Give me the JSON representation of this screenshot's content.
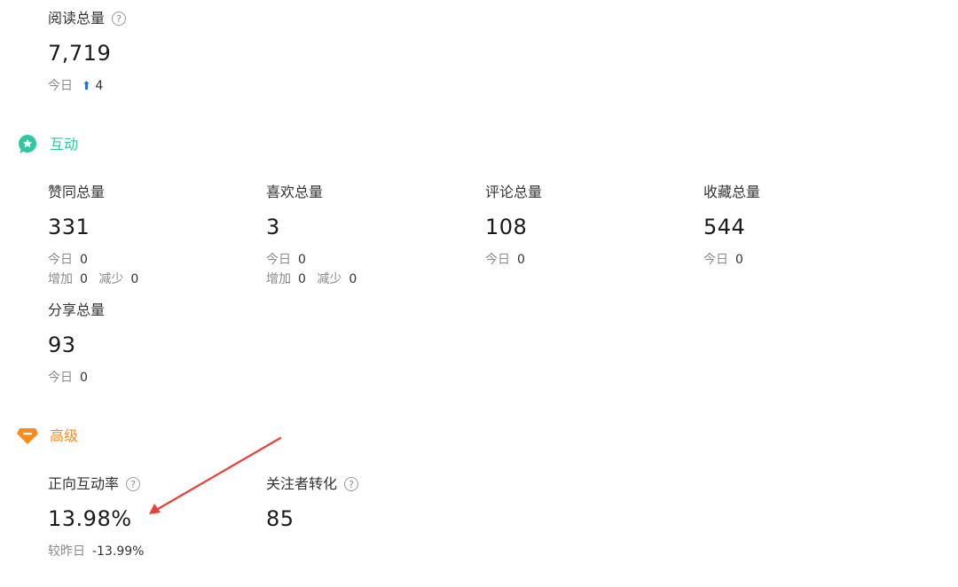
{
  "reading": {
    "title": "阅读总量",
    "help_icon": "question-circle-icon",
    "value": "7,719",
    "today_label": "今日",
    "today_value": "4",
    "trend_icon": "arrow-up-icon"
  },
  "interaction": {
    "title": "互动",
    "icon": "star-chat-bubble-icon",
    "color": "#2fc8a0",
    "metrics": [
      {
        "label": "赞同总量",
        "value": "331",
        "today_label": "今日",
        "today_value": "0",
        "inc_label": "增加",
        "inc_value": "0",
        "dec_label": "减少",
        "dec_value": "0"
      },
      {
        "label": "喜欢总量",
        "value": "3",
        "today_label": "今日",
        "today_value": "0",
        "inc_label": "增加",
        "inc_value": "0",
        "dec_label": "减少",
        "dec_value": "0"
      },
      {
        "label": "评论总量",
        "value": "108",
        "today_label": "今日",
        "today_value": "0"
      },
      {
        "label": "收藏总量",
        "value": "544",
        "today_label": "今日",
        "today_value": "0"
      },
      {
        "label": "分享总量",
        "value": "93",
        "today_label": "今日",
        "today_value": "0"
      }
    ]
  },
  "advanced": {
    "title": "高级",
    "icon": "diamond-icon",
    "color": "#ff8c1a",
    "metrics": [
      {
        "label": "正向互动率",
        "help_icon": "question-circle-icon",
        "value": "13.98%",
        "compare_label": "较昨日",
        "compare_value": "-13.99%"
      },
      {
        "label": "关注者转化",
        "help_icon": "question-circle-icon",
        "value": "85"
      }
    ]
  },
  "annotation": {
    "color": "#e8413b"
  }
}
